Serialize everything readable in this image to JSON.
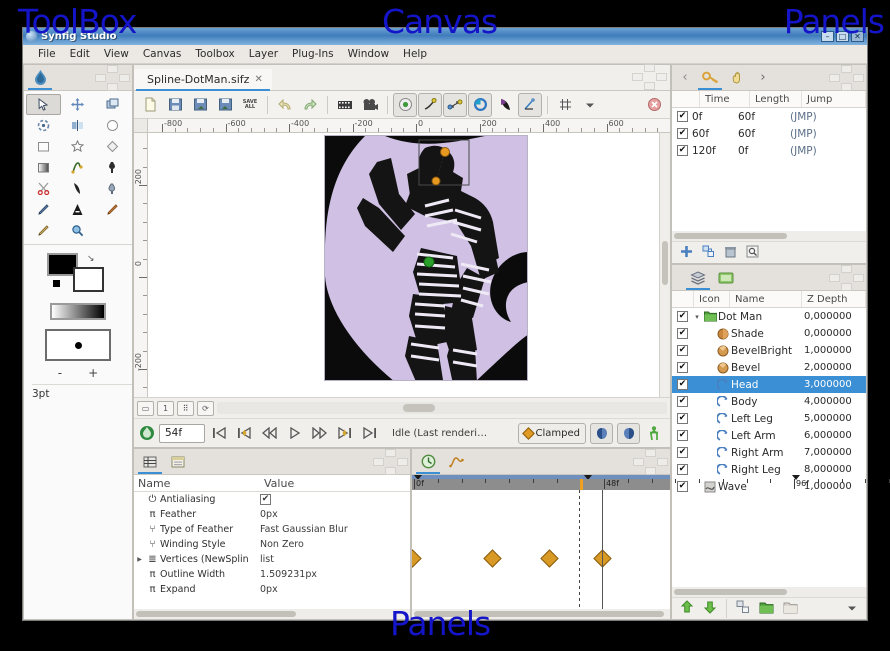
{
  "annotations": {
    "toolbox": "ToolBox",
    "canvas": "Canvas",
    "panels_top_right": "Panels",
    "panels_bottom": "Panels"
  },
  "window": {
    "title": "Synfig Studio",
    "minimize": "–",
    "maximize": "□",
    "close": "✕"
  },
  "menubar": {
    "items": [
      "File",
      "Edit",
      "View",
      "Canvas",
      "Toolbox",
      "Layer",
      "Plug-Ins",
      "Window",
      "Help"
    ]
  },
  "toolbox": {
    "tab_icon": "synfig-logo-icon",
    "tools": [
      {
        "name": "transform-tool",
        "glyph": "↖",
        "selected": true
      },
      {
        "name": "smooth-move-tool",
        "glyph": "✥",
        "selected": false
      },
      {
        "name": "scale-tool",
        "glyph": "⧉",
        "selected": false
      },
      {
        "name": "rotate-tool",
        "glyph": "⟳",
        "selected": false
      },
      {
        "name": "mirror-tool",
        "glyph": "◧",
        "selected": false
      },
      {
        "name": "circle-tool",
        "glyph": "○",
        "selected": false
      },
      {
        "name": "rectangle-tool",
        "glyph": "▢",
        "selected": false
      },
      {
        "name": "star-tool",
        "glyph": "☆",
        "selected": false
      },
      {
        "name": "gradient-tool",
        "glyph": "◇",
        "selected": false
      },
      {
        "name": "polygon-tool",
        "glyph": "◧",
        "selected": false
      },
      {
        "name": "spline-tool",
        "glyph": "ʃ",
        "selected": false
      },
      {
        "name": "fill-tool",
        "glyph": "⬤",
        "selected": false
      },
      {
        "name": "cutout-tool",
        "glyph": "✂",
        "selected": false
      },
      {
        "name": "width-tool",
        "glyph": "◗",
        "selected": false
      },
      {
        "name": "eyedrop-tool",
        "glyph": "⚗",
        "selected": false
      },
      {
        "name": "draw-tool",
        "glyph": "✎",
        "selected": false
      },
      {
        "name": "text-tool",
        "glyph": "A",
        "selected": false
      },
      {
        "name": "sketch-tool",
        "glyph": "✏",
        "selected": false
      },
      {
        "name": "brush-tool",
        "glyph": "🖌",
        "selected": false
      },
      {
        "name": "zoom-tool",
        "glyph": "🔍",
        "selected": false
      }
    ],
    "colors": {
      "foreground": "#000000",
      "background": "#ffffff",
      "gradient_from": "#ffffff",
      "gradient_to": "#000000"
    },
    "brush_minus": "-",
    "brush_plus": "+",
    "brush_size": "3pt"
  },
  "canvas": {
    "tab_label": "Spline-DotMan.sifz",
    "tab_close": "✕",
    "toolbar": [
      {
        "name": "new-document-button",
        "glyph": "📄"
      },
      {
        "name": "save-button",
        "glyph": "💾"
      },
      {
        "name": "save-as-button",
        "glyph": "💾"
      },
      {
        "name": "save-all-button",
        "glyph": "💾"
      },
      {
        "name": "save-all-label-button",
        "glyph": "SAVE ALL"
      },
      {
        "name": "undo-button",
        "glyph": "↶"
      },
      {
        "name": "redo-button",
        "glyph": "↷"
      },
      {
        "name": "render-button",
        "glyph": "🎞"
      },
      {
        "name": "preview-button",
        "glyph": "🎥"
      },
      {
        "name": "toggle-background-rendering-button",
        "glyph": "◉"
      },
      {
        "name": "toggle-low-res-button",
        "glyph": "✎"
      },
      {
        "name": "toggle-onion-skin-button",
        "glyph": "⚙"
      },
      {
        "name": "refresh-button",
        "glyph": "◐"
      },
      {
        "name": "toggle-alpha-button",
        "glyph": "◤"
      },
      {
        "name": "toggle-guides-button",
        "glyph": "📐"
      },
      {
        "name": "toggle-grid-button",
        "glyph": "▦"
      },
      {
        "name": "options-dropdown-button",
        "glyph": "▾"
      },
      {
        "name": "close-canvas-button",
        "glyph": "✕"
      }
    ],
    "ruler_h_labels": [
      "-800",
      "-600",
      "-400",
      "-200",
      "0",
      "200",
      "400",
      "600"
    ],
    "ruler_v_labels": [
      "200",
      "0",
      "-200"
    ],
    "artboard_bg": "#cfc0e4"
  },
  "playback": {
    "current_time": "54f",
    "buttons": [
      {
        "name": "seek-begin-button",
        "glyph": "⏮"
      },
      {
        "name": "seek-prev-keyframe-button",
        "glyph": "⏮"
      },
      {
        "name": "seek-prev-frame-button",
        "glyph": "◀◀"
      },
      {
        "name": "play-button",
        "glyph": "▷"
      },
      {
        "name": "seek-next-frame-button",
        "glyph": "▶▶"
      },
      {
        "name": "seek-next-keyframe-button",
        "glyph": "⏭"
      },
      {
        "name": "seek-end-button",
        "glyph": "⏭"
      }
    ],
    "status": "Idle (Last renderi…",
    "interpolation": "Clamped",
    "bone_setup_label": "bone-setup-icon",
    "past_onion_label": "past-onion-icon",
    "future_onion_label": "future-onion-icon",
    "animate_mode_label": "animate-mode-icon"
  },
  "keyframes_panel": {
    "tabs": [
      {
        "name": "keyframes-tab",
        "glyph": "🔑",
        "active": true
      },
      {
        "name": "navigator-tab",
        "glyph": "✋",
        "active": false
      }
    ],
    "nav_prev": "‹",
    "nav_next": "›",
    "columns": [
      "Time",
      "Length",
      "Jump"
    ],
    "rows": [
      {
        "checked": true,
        "time": "0f",
        "length": "60f",
        "jump": "(JMP)"
      },
      {
        "checked": true,
        "time": "60f",
        "length": "60f",
        "jump": "(JMP)"
      },
      {
        "checked": true,
        "time": "120f",
        "length": "0f",
        "jump": "(JMP)"
      }
    ],
    "footer_buttons": [
      {
        "name": "add-keyframe-button",
        "glyph": "✚"
      },
      {
        "name": "duplicate-keyframe-button",
        "glyph": "❏"
      },
      {
        "name": "remove-keyframe-button",
        "glyph": "🗑"
      },
      {
        "name": "keyframe-properties-button",
        "glyph": "🔍"
      }
    ]
  },
  "layers_panel": {
    "tabs": [
      {
        "name": "layers-tab",
        "glyph": "▤",
        "active": true
      },
      {
        "name": "library-tab",
        "glyph": "🗂",
        "active": false
      }
    ],
    "columns": [
      "Icon",
      "Name",
      "Z Depth"
    ],
    "rows": [
      {
        "checked": true,
        "twisty": "▾",
        "icon": "group-icon",
        "name": "Dot Man",
        "z": "0,000000",
        "indent": 0,
        "selected": false
      },
      {
        "checked": true,
        "twisty": "",
        "icon": "shade-icon",
        "name": "Shade",
        "z": "0,000000",
        "indent": 1,
        "selected": false
      },
      {
        "checked": true,
        "twisty": "",
        "icon": "bevel-icon",
        "name": "BevelBright",
        "z": "1,000000",
        "indent": 1,
        "selected": false
      },
      {
        "checked": true,
        "twisty": "",
        "icon": "bevel-icon",
        "name": "Bevel",
        "z": "2,000000",
        "indent": 1,
        "selected": false
      },
      {
        "checked": true,
        "twisty": "",
        "icon": "region-icon",
        "name": "Head",
        "z": "3,000000",
        "indent": 1,
        "selected": true
      },
      {
        "checked": true,
        "twisty": "",
        "icon": "region-icon",
        "name": "Body",
        "z": "4,000000",
        "indent": 1,
        "selected": false
      },
      {
        "checked": true,
        "twisty": "",
        "icon": "region-icon",
        "name": "Left Leg",
        "z": "5,000000",
        "indent": 1,
        "selected": false
      },
      {
        "checked": true,
        "twisty": "",
        "icon": "region-icon",
        "name": "Left Arm",
        "z": "6,000000",
        "indent": 1,
        "selected": false
      },
      {
        "checked": true,
        "twisty": "",
        "icon": "region-icon",
        "name": "Right Arm",
        "z": "7,000000",
        "indent": 1,
        "selected": false
      },
      {
        "checked": true,
        "twisty": "",
        "icon": "region-icon",
        "name": "Right Leg",
        "z": "8,000000",
        "indent": 1,
        "selected": false
      },
      {
        "checked": true,
        "twisty": "",
        "icon": "warp-icon",
        "name": "Wave",
        "z": "1,000000",
        "indent": 0,
        "selected": false
      }
    ],
    "footer_buttons": [
      {
        "name": "raise-layer-button",
        "glyph": "⬆"
      },
      {
        "name": "lower-layer-button",
        "glyph": "⬇"
      },
      {
        "name": "duplicate-layer-button",
        "glyph": "❏"
      },
      {
        "name": "group-layer-button",
        "glyph": "📁"
      },
      {
        "name": "ungroup-layer-button",
        "glyph": "📂"
      },
      {
        "name": "layer-menu-button",
        "glyph": "▾"
      }
    ]
  },
  "params_panel": {
    "tabs": [
      {
        "name": "params-tab",
        "glyph": "▦",
        "active": true
      },
      {
        "name": "children-tab",
        "glyph": "🗒",
        "active": false
      }
    ],
    "columns": [
      "Name",
      "Value"
    ],
    "rows": [
      {
        "expander": "",
        "icon": "power-icon",
        "name": "Antialiasing",
        "value": "✔",
        "is_check": true
      },
      {
        "expander": "",
        "icon": "pi-icon",
        "name": "Feather",
        "value": "0px",
        "is_check": false
      },
      {
        "expander": "",
        "icon": "enum-icon",
        "name": "Type of Feather",
        "value": "Fast Gaussian Blur",
        "is_check": false
      },
      {
        "expander": "",
        "icon": "enum-icon",
        "name": "Winding Style",
        "value": "Non Zero",
        "is_check": false
      },
      {
        "expander": "▶",
        "icon": "list-icon",
        "name": "Vertices (NewSplin",
        "value": "list",
        "is_check": false
      },
      {
        "expander": "",
        "icon": "pi-icon",
        "name": "Outline Width",
        "value": "1.509231px",
        "is_check": false
      },
      {
        "expander": "",
        "icon": "pi-icon",
        "name": "Expand",
        "value": "0px",
        "is_check": false
      }
    ]
  },
  "timetrack_panel": {
    "tabs": [
      {
        "name": "timetrack-tab",
        "glyph": "⏱",
        "active": true
      },
      {
        "name": "curves-tab",
        "glyph": "📈",
        "active": false
      }
    ],
    "ruler_labels": [
      "0f",
      "48f",
      "96f"
    ],
    "time_cursor": "48f",
    "keyframes_x": [
      0,
      80,
      137,
      190,
      366
    ]
  },
  "colors": {
    "accent": "#3b8fd4",
    "selection": "#3b8fd4",
    "keyframe": "#d89a25",
    "annotation": "#1414c8",
    "titlebar": "#3f7cba"
  }
}
